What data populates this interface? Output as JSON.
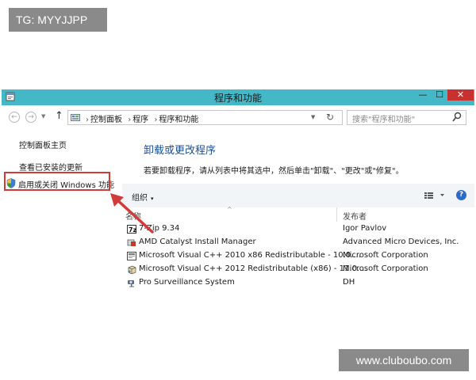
{
  "watermark_tag": "TG: MYYJJPP",
  "watermark_site": "www.cluboubo.com",
  "window": {
    "title": "程序和功能",
    "controls": {
      "minimize": "—",
      "maximize": "☐",
      "close": "✕"
    }
  },
  "address_bar": {
    "back": "←",
    "forward": "→",
    "up": "↑",
    "breadcrumbs": [
      "控制面板",
      "程序",
      "程序和功能"
    ],
    "separator": "›",
    "refresh": "↻",
    "search_placeholder": "搜索\"程序和功能\""
  },
  "left_pane": {
    "home": "控制面板主页",
    "view_updates": "查看已安装的更新",
    "windows_features": "启用或关闭 Windows 功能"
  },
  "content": {
    "heading": "卸载或更改程序",
    "hint": "若要卸载程序，请从列表中将其选中，然后单击\"卸载\"、\"更改\"或\"修复\"。",
    "toolbar": {
      "organize": "组织",
      "caret": "▾",
      "help": "?"
    },
    "columns": {
      "name": "名称",
      "publisher": "发布者",
      "sort_caret": "^"
    },
    "programs": [
      {
        "name": "7-Zip 9.34",
        "publisher": "Igor Pavlov",
        "icon": "7zip-icon"
      },
      {
        "name": "AMD Catalyst Install Manager",
        "publisher": "Advanced Micro Devices, Inc.",
        "icon": "amd-icon"
      },
      {
        "name": "Microsoft Visual C++ 2010  x86 Redistributable - 10.0....",
        "publisher": "Microsoft Corporation",
        "icon": "installer-icon"
      },
      {
        "name": "Microsoft Visual C++ 2012 Redistributable (x86) - 11.0....",
        "publisher": "Microsoft Corporation",
        "icon": "installer-box-icon"
      },
      {
        "name": "Pro Surveillance System",
        "publisher": "DH",
        "icon": "camera-icon"
      }
    ]
  },
  "colors": {
    "titlebar": "#45b8c8",
    "close_button": "#c7312f",
    "heading": "#1d4f91",
    "highlight": "#d23b3b",
    "watermark_bg": "#8a8a8a"
  }
}
